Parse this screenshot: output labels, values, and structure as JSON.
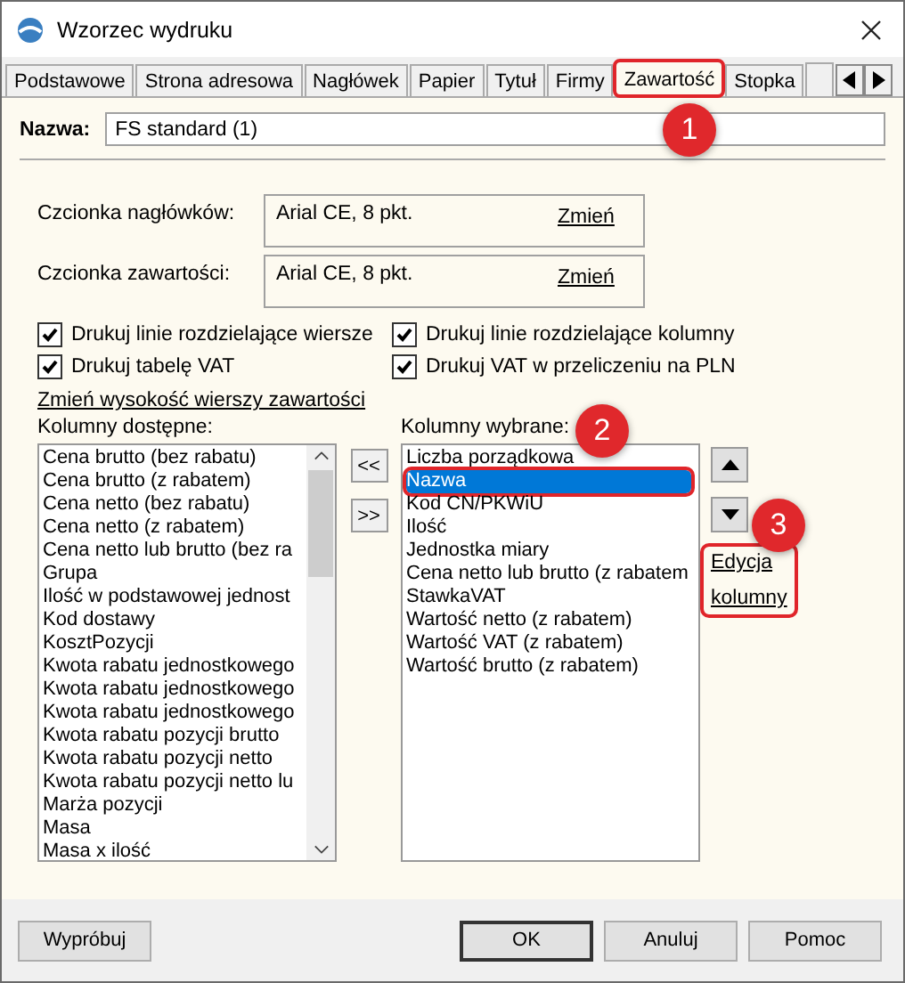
{
  "window": {
    "title": "Wzorzec wydruku"
  },
  "tabs": [
    {
      "label": "Podstawowe",
      "selected": false,
      "highlighted": false
    },
    {
      "label": "Strona adresowa",
      "selected": false,
      "highlighted": false
    },
    {
      "label": "Nagłówek",
      "selected": false,
      "highlighted": false
    },
    {
      "label": "Papier",
      "selected": false,
      "highlighted": false
    },
    {
      "label": "Tytuł",
      "selected": false,
      "highlighted": false
    },
    {
      "label": "Firmy",
      "selected": false,
      "highlighted": false
    },
    {
      "label": "Zawartość",
      "selected": true,
      "highlighted": true
    },
    {
      "label": "Stopka",
      "selected": false,
      "highlighted": false
    }
  ],
  "name_field": {
    "label": "Nazwa:",
    "value": "FS standard (1)"
  },
  "fonts": [
    {
      "label": "Czcionka nagłówków:",
      "value": "Arial CE, 8 pkt.",
      "link": "Zmień"
    },
    {
      "label": "Czcionka zawartości:",
      "value": "Arial CE, 8 pkt.",
      "link": "Zmień"
    }
  ],
  "checkboxes": [
    {
      "label": "Drukuj linie rozdzielające wiersze",
      "checked": true
    },
    {
      "label": "Drukuj linie rozdzielające kolumny",
      "checked": true
    },
    {
      "label": "Drukuj tabelę VAT",
      "checked": true
    },
    {
      "label": "Drukuj VAT w przeliczeniu na PLN",
      "checked": true
    }
  ],
  "row_height_link": "Zmień wysokość wierszy zawartości",
  "available": {
    "label": "Kolumny dostępne:",
    "items": [
      "Cena brutto (bez rabatu)",
      "Cena brutto (z rabatem)",
      "Cena netto (bez rabatu)",
      "Cena netto (z rabatem)",
      "Cena netto lub brutto (bez ra",
      "Grupa",
      "Ilość w podstawowej jednost",
      "Kod dostawy",
      "KosztPozycji",
      "Kwota rabatu jednostkowego",
      "Kwota rabatu jednostkowego",
      "Kwota rabatu jednostkowego",
      "Kwota rabatu pozycji brutto",
      "Kwota rabatu pozycji netto",
      "Kwota rabatu pozycji netto lu",
      "Marża pozycji",
      "Masa",
      "Masa x ilość"
    ]
  },
  "move_buttons": [
    "<<",
    ">>"
  ],
  "selected_columns": {
    "label": "Kolumny wybrane:",
    "items": [
      {
        "text": "Liczba porządkowa",
        "selected": false,
        "highlighted": false
      },
      {
        "text": "Nazwa",
        "selected": true,
        "highlighted": true
      },
      {
        "text": "Kod CN/PKWiU",
        "selected": false,
        "highlighted": false
      },
      {
        "text": "Ilość",
        "selected": false,
        "highlighted": false
      },
      {
        "text": "Jednostka miary",
        "selected": false,
        "highlighted": false
      },
      {
        "text": "Cena netto lub brutto (z rabatem",
        "selected": false,
        "highlighted": false
      },
      {
        "text": "StawkaVAT",
        "selected": false,
        "highlighted": false
      },
      {
        "text": "Wartość netto (z rabatem)",
        "selected": false,
        "highlighted": false
      },
      {
        "text": "Wartość VAT (z rabatem)",
        "selected": false,
        "highlighted": false
      },
      {
        "text": "Wartość brutto (z rabatem)",
        "selected": false,
        "highlighted": false
      }
    ]
  },
  "edit_link": {
    "lines": [
      "Edycja",
      "kolumny"
    ],
    "highlighted": true
  },
  "annotations": [
    {
      "label": "1",
      "kind": "tab"
    },
    {
      "label": "2",
      "kind": "list"
    },
    {
      "label": "3",
      "kind": "link"
    }
  ],
  "footer_buttons": [
    {
      "label": "Wypróbuj",
      "default": false
    },
    {
      "label": "OK",
      "default": true
    },
    {
      "label": "Anuluj",
      "default": false
    },
    {
      "label": "Pomoc",
      "default": false
    }
  ]
}
